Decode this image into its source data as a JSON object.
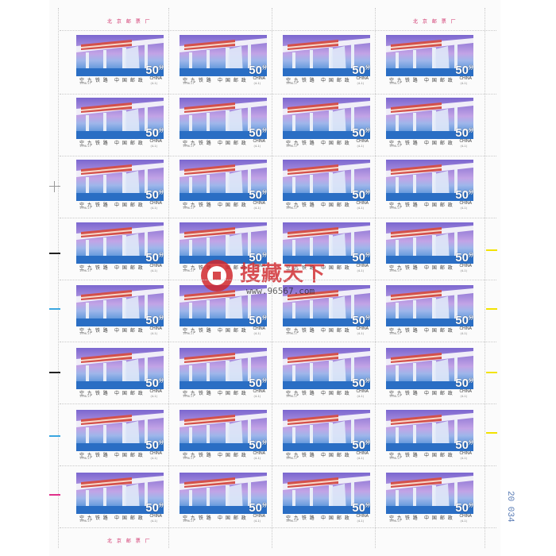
{
  "sheet": {
    "rows": 8,
    "cols": 4,
    "stamp": {
      "denomination": "50",
      "denomination_unit": "分",
      "country": "CHINA",
      "caption_left": "空 九 铁 路",
      "caption_middle": "中 国 邮 政",
      "code_left": "1996-17",
      "code_right": "(4-1)"
    },
    "imprint_top_left": "北 京 邮 票 厂",
    "imprint_top_right": "北 京 邮 票 厂",
    "imprint_bottom": "北 京 邮 票 厂",
    "serial_number": "20 034"
  },
  "watermark": {
    "title": "搜藏天下",
    "url": "www.96567.com"
  },
  "colors": {
    "sky_top": "#8a7ad6",
    "sky_mid": "#b89be0",
    "water": "#2f7fd0",
    "pillar": "#e9eef8",
    "train": "#d4504a",
    "imprint": "#d0306a",
    "margin_black": "#222222",
    "margin_cyan": "#3aa6e0",
    "margin_yellow": "#f2e200",
    "margin_magenta": "#e0308a"
  }
}
